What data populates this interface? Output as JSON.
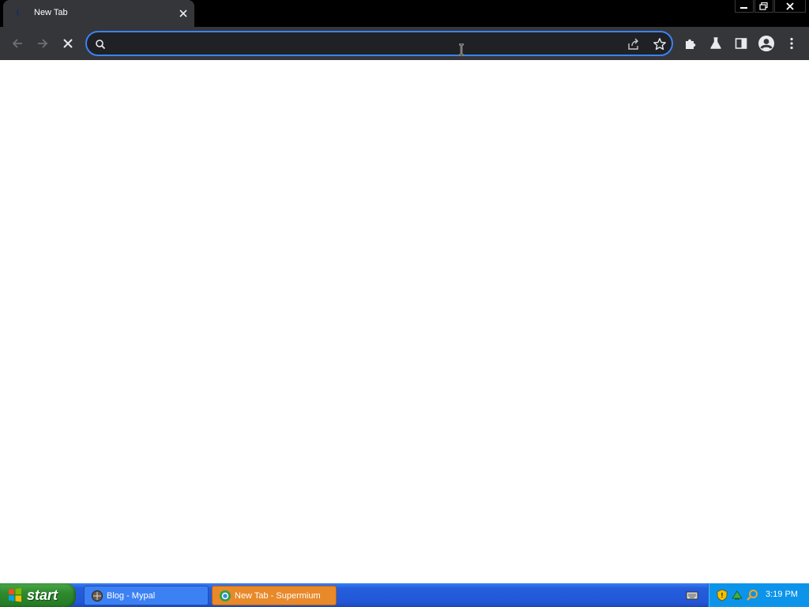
{
  "browser": {
    "tab": {
      "title": "New Tab"
    },
    "omnibox": {
      "value": "",
      "placeholder": ""
    }
  },
  "taskbar": {
    "start_label": "start",
    "tasks": [
      {
        "label": "Blog - Mypal"
      },
      {
        "label": "New Tab - Supermium"
      }
    ],
    "clock": "3:19 PM"
  },
  "colors": {
    "titlebar": "#000000",
    "toolbar": "#35363a",
    "omnibox_border": "#3b82f6",
    "taskbar_blue": "#245edc",
    "start_green": "#2f8a2f",
    "active_task": "#e8892a",
    "tray": "#0c93ea"
  },
  "icons": [
    "loading-spinner-icon",
    "close-icon",
    "minimize-icon",
    "restore-icon",
    "back-arrow-icon",
    "forward-arrow-icon",
    "stop-icon",
    "search-icon",
    "share-icon",
    "star-icon",
    "puzzle-icon",
    "flask-icon",
    "side-panel-icon",
    "profile-icon",
    "more-vert-icon",
    "windows-logo-icon",
    "mypal-icon",
    "supermium-icon",
    "keyboard-icon",
    "security-shield-icon",
    "network-icon",
    "search-tray-icon"
  ]
}
